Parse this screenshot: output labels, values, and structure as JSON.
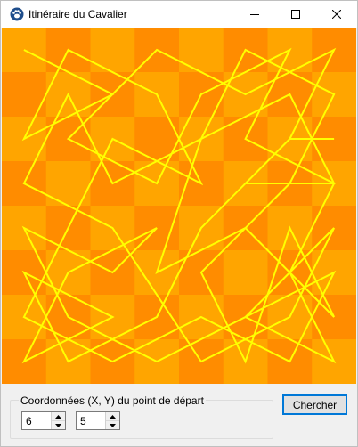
{
  "window": {
    "title": "Itinéraire du Cavalier",
    "icon": "paw-icon",
    "controls": [
      "minimize-icon",
      "maximize-icon",
      "close-icon"
    ]
  },
  "board": {
    "cols": 8,
    "rows": 8,
    "colors": {
      "light": "#ffa500",
      "dark": "#ff8c00",
      "path": "#ffff00"
    },
    "path": [
      [
        0,
        0
      ],
      [
        2,
        1
      ],
      [
        0,
        2
      ],
      [
        1,
        0
      ],
      [
        3,
        1
      ],
      [
        4,
        3
      ],
      [
        2,
        2
      ],
      [
        1,
        4
      ],
      [
        0,
        6
      ],
      [
        2,
        7
      ],
      [
        4,
        6
      ],
      [
        6,
        7
      ],
      [
        7,
        5
      ],
      [
        5,
        6
      ],
      [
        7,
        7
      ],
      [
        6,
        5
      ],
      [
        7,
        3
      ],
      [
        5,
        2
      ],
      [
        6,
        0
      ],
      [
        4,
        1
      ],
      [
        3,
        3
      ],
      [
        1,
        2
      ],
      [
        3,
        0
      ],
      [
        5,
        1
      ],
      [
        7,
        0
      ],
      [
        6,
        2
      ],
      [
        4,
        4
      ],
      [
        3,
        6
      ],
      [
        1,
        7
      ],
      [
        0,
        5
      ],
      [
        2,
        6
      ],
      [
        0,
        7
      ],
      [
        1,
        5
      ],
      [
        3,
        4
      ],
      [
        2,
        5
      ],
      [
        0,
        4
      ],
      [
        1,
        6
      ],
      [
        3,
        7
      ],
      [
        5,
        6
      ],
      [
        7,
        4
      ],
      [
        6,
        6
      ],
      [
        4,
        7
      ],
      [
        2,
        4
      ],
      [
        0,
        3
      ],
      [
        1,
        1
      ],
      [
        2,
        3
      ],
      [
        4,
        2
      ],
      [
        3,
        5
      ],
      [
        5,
        4
      ],
      [
        7,
        6
      ],
      [
        6,
        4
      ],
      [
        5,
        7
      ],
      [
        4,
        5
      ],
      [
        6,
        3
      ],
      [
        7,
        1
      ],
      [
        5,
        0
      ],
      [
        4,
        2
      ],
      [
        6,
        1
      ],
      [
        7,
        3
      ],
      [
        5,
        3
      ],
      [
        6,
        2
      ],
      [
        7,
        2
      ]
    ]
  },
  "form": {
    "group_label": "Coordonnées (X, Y) du point de départ",
    "x_value": "6",
    "y_value": "5",
    "search_label": "Chercher"
  }
}
